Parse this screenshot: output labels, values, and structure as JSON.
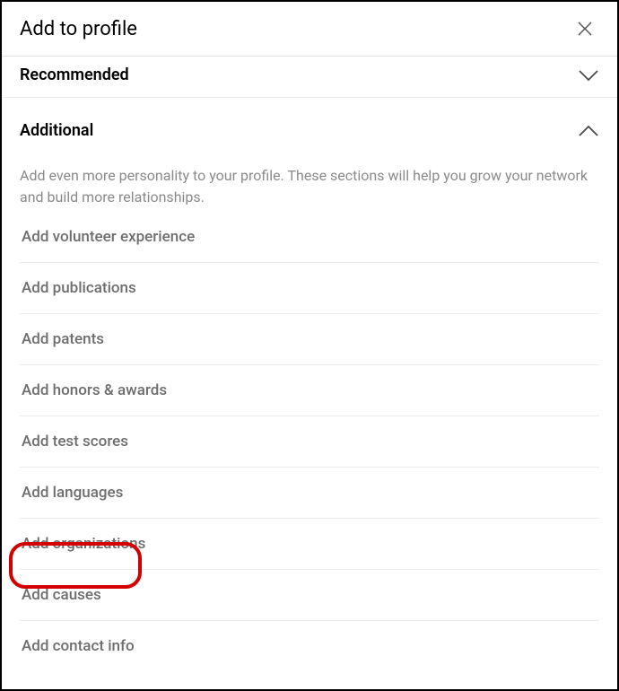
{
  "header": {
    "title": "Add to profile"
  },
  "sections": {
    "recommended": {
      "title": "Recommended"
    },
    "additional": {
      "title": "Additional",
      "description": "Add even more personality to your profile. These sections will help you grow your network and build more relationships.",
      "items": [
        {
          "label": "Add volunteer experience"
        },
        {
          "label": "Add publications"
        },
        {
          "label": "Add patents"
        },
        {
          "label": "Add honors & awards"
        },
        {
          "label": "Add test scores"
        },
        {
          "label": "Add languages"
        },
        {
          "label": "Add organizations"
        },
        {
          "label": "Add causes"
        },
        {
          "label": "Add contact info"
        }
      ]
    }
  }
}
